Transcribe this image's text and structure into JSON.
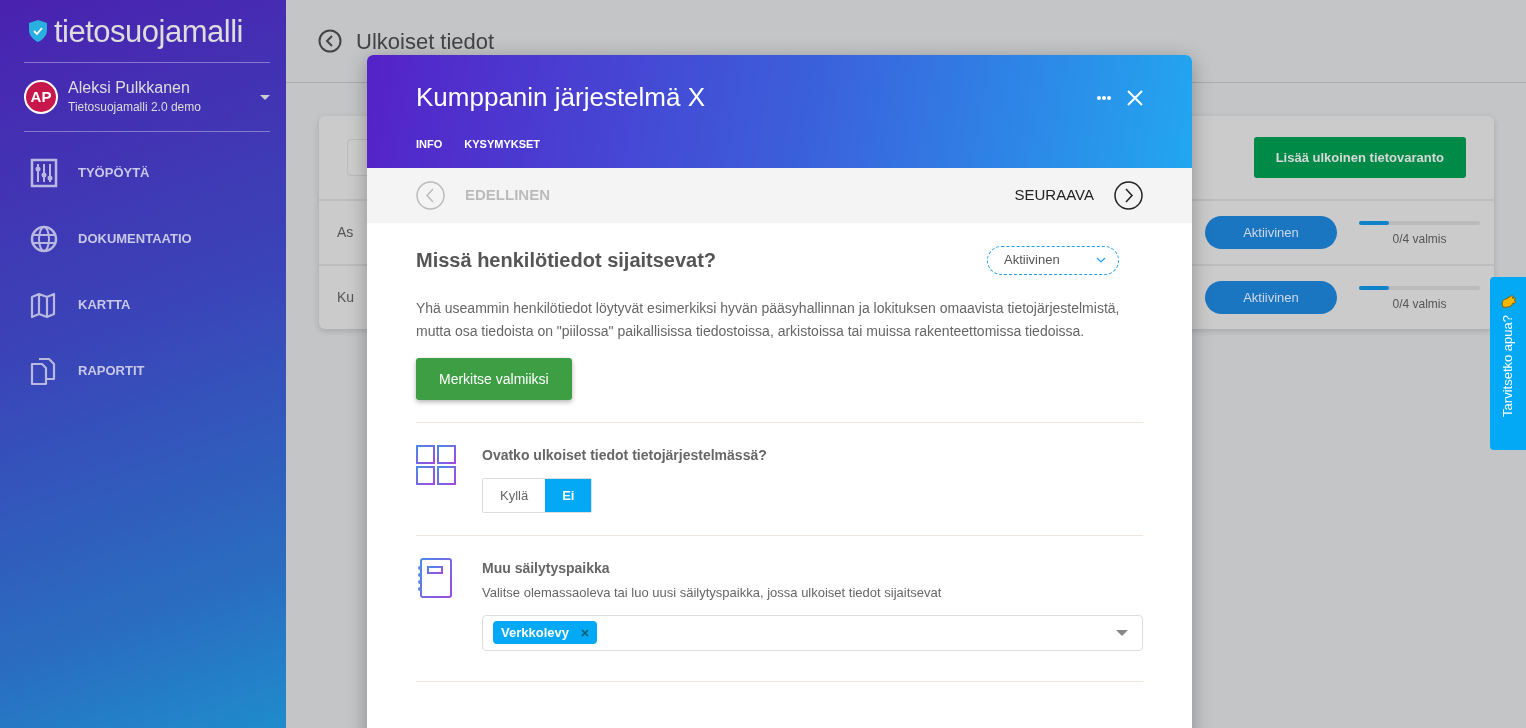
{
  "sidebar": {
    "logo": "tietosuojamalli",
    "user": {
      "initials": "AP",
      "name": "Aleksi Pulkkanen",
      "org": "Tietosuojamalli 2.0 demo"
    },
    "items": [
      {
        "label": "TYÖPÖYTÄ"
      },
      {
        "label": "DOKUMENTAATIO"
      },
      {
        "label": "KARTTA"
      },
      {
        "label": "RAPORTIT"
      }
    ]
  },
  "page": {
    "title": "Ulkoiset tiedot",
    "add_button": "Lisää ulkoinen tietovaranto",
    "rows": [
      {
        "name": "As",
        "status": "Aktiivinen",
        "level": 0.25,
        "progress": "0/4 valmis"
      },
      {
        "name": "Ku",
        "status": "Aktiivinen",
        "level": 0.25,
        "progress": "0/4 valmis"
      }
    ]
  },
  "help_tab": {
    "label": "Tarvitsetko apua?"
  },
  "modal": {
    "title": "Kumppanin järjestelmä X",
    "tabs": [
      "INFO",
      "KYSYMYKSET"
    ],
    "prev": {
      "label": "EDELLINEN",
      "disabled": true
    },
    "next": {
      "label": "SEURAAVA",
      "disabled": false
    },
    "question": {
      "title": "Missä henkilötiedot sijaitsevat?",
      "status": "Aktiivinen",
      "text": "Yhä useammin henkilötiedot löytyvät esimerkiksi hyvän pääsyhallinnan ja lokituksen omaavista tietojärjestelmistä, mutta osa tiedoista on \"piilossa\" paikallisissa tiedostoissa, arkistoissa tai muissa rakenteettomissa tiedoissa.",
      "done_button": "Merkitse valmiiksi"
    },
    "fields": [
      {
        "kind": "toggle",
        "label": "Ovatko ulkoiset tiedot tietojärjestelmässä?",
        "options": [
          {
            "label": "Kyllä",
            "selected": false
          },
          {
            "label": "Ei",
            "selected": true
          }
        ]
      },
      {
        "kind": "tags",
        "label": "Muu säilytyspaikka",
        "help": "Valitse olemassaoleva tai luo uusi säilytyspaikka, jossa ulkoiset tiedot sijaitsevat",
        "tags": [
          "Verkkolevy"
        ]
      }
    ]
  }
}
